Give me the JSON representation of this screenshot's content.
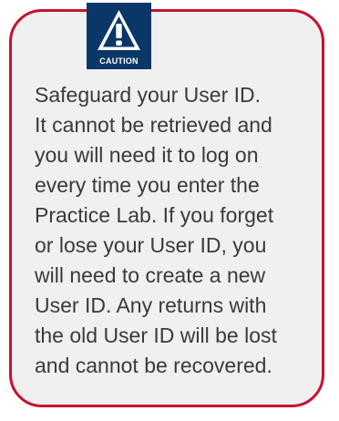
{
  "caution": {
    "icon": "caution-warning-icon",
    "label": "CAUTION",
    "message": "Safeguard your User ID.\nIt cannot be retrieved and\nyou will need it to log on\nevery time you enter the\nPractice Lab. If you forget\nor lose your User ID, you\nwill need to create a new\nUser ID. Any returns with\nthe old User ID will be lost\nand cannot be recovered."
  },
  "colors": {
    "border": "#c8102e",
    "icon_background": "#0a3767",
    "box_background": "#f0f0f0",
    "text": "#3a3a3a"
  }
}
